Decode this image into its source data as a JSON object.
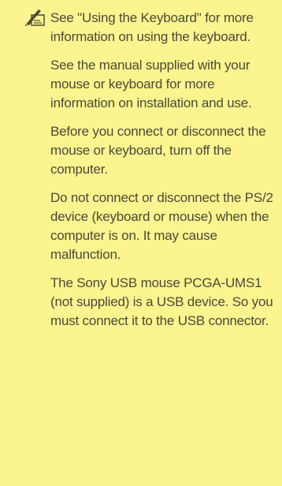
{
  "note": {
    "icon": "writing-hand-icon",
    "background_color": "#fcf48f",
    "paragraphs": [
      "See \"Using the Keyboard\" for more information on using the keyboard.",
      "See the manual supplied with your mouse or keyboard for more information on installation and use.",
      "Before you connect or disconnect the mouse or keyboard, turn off the computer.",
      "Do not connect or disconnect the PS/2 device (keyboard or mouse) when the computer is on. It may cause malfunction.",
      "The Sony USB mouse PCGA-UMS1 (not supplied) is a USB device. So you must connect it to the USB connector."
    ]
  }
}
